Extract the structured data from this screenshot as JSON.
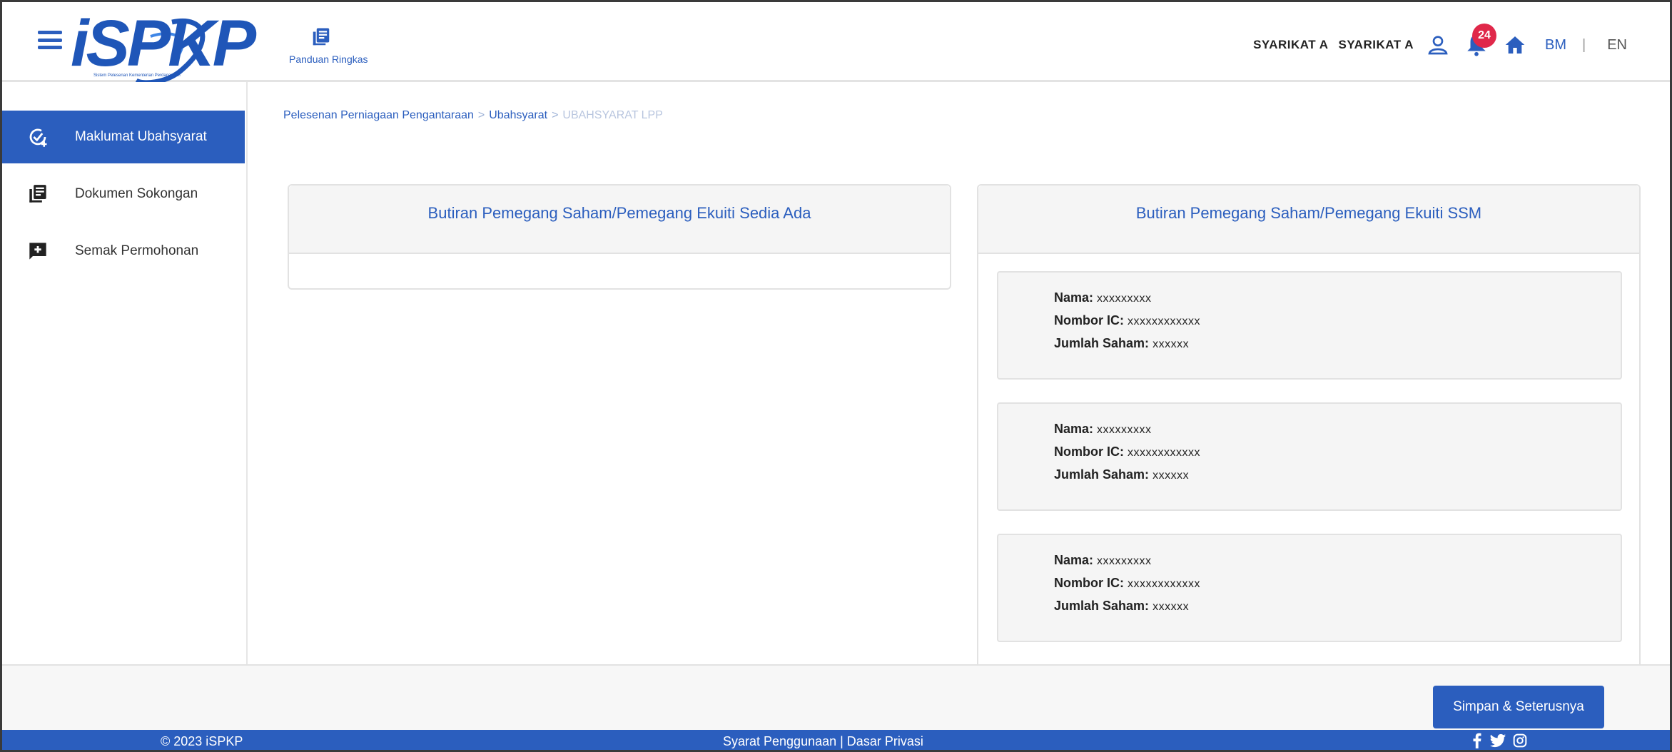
{
  "header": {
    "logo_text": "iSPKP",
    "logo_tagline": "Sistem Pelesenan Kementerian Perdagangan",
    "guide_label": "Panduan Ringkas",
    "company_1": "SYARIKAT A",
    "company_2": "SYARIKAT A",
    "notification_count": "24",
    "lang_bm": "BM",
    "lang_sep": "|",
    "lang_en": "EN"
  },
  "sidebar": {
    "items": [
      {
        "label": "Maklumat Ubahsyarat",
        "icon": "check-plus-icon",
        "active": true
      },
      {
        "label": "Dokumen Sokongan",
        "icon": "document-icon",
        "active": false
      },
      {
        "label": "Semak Permohonan",
        "icon": "add-comment-icon",
        "active": false
      }
    ]
  },
  "breadcrumb": {
    "item_1": "Pelesenan Perniagaan Pengantaraan",
    "item_2": "Ubahsyarat",
    "item_3": "UBAHSYARAT LPP",
    "separator": ">"
  },
  "panels": {
    "left_title": "Butiran Pemegang Saham/Pemegang Ekuiti Sedia Ada",
    "right_title": "Butiran Pemegang Saham/Pemegang Ekuiti SSM"
  },
  "holders": [
    {
      "name_label": "Nama:",
      "name_value": "xxxxxxxxx",
      "ic_label": "Nombor IC:",
      "ic_value": "xxxxxxxxxxxx",
      "shares_label": "Jumlah Saham:",
      "shares_value": "xxxxxx"
    },
    {
      "name_label": "Nama:",
      "name_value": "xxxxxxxxx",
      "ic_label": "Nombor IC:",
      "ic_value": "xxxxxxxxxxxx",
      "shares_label": "Jumlah Saham:",
      "shares_value": "xxxxxx"
    },
    {
      "name_label": "Nama:",
      "name_value": "xxxxxxxxx",
      "ic_label": "Nombor IC:",
      "ic_value": "xxxxxxxxxxxx",
      "shares_label": "Jumlah Saham:",
      "shares_value": "xxxxxx"
    }
  ],
  "actions": {
    "next_label": "Simpan & Seterusnya"
  },
  "footer": {
    "copyright": "© 2023 iSPKP",
    "links": "Syarat Penggunaan | Dasar Privasi",
    "social": [
      "facebook-icon",
      "twitter-icon",
      "instagram-icon"
    ]
  },
  "colors": {
    "primary": "#2b5ebe",
    "badge": "#e0284a"
  }
}
